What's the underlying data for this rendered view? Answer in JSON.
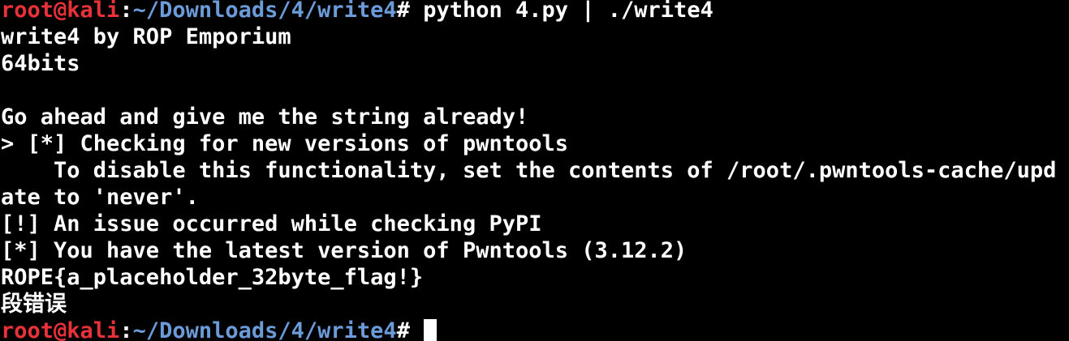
{
  "prompt": {
    "user_host": "root@kali",
    "separator": ":",
    "path": "~/Downloads/4/write4",
    "symbol": "#"
  },
  "first_command": " python 4.py | ./write4",
  "output": {
    "line_1": "write4 by ROP Emporium",
    "line_2": "64bits",
    "line_3": "",
    "line_4": "Go ahead and give me the string already!",
    "line_5": "> [*] Checking for new versions of pwntools",
    "line_6": "    To disable this functionality, set the contents of /root/.pwntools-cache/upd",
    "line_7": "ate to 'never'.",
    "line_8": "[!] An issue occurred while checking PyPI",
    "line_9": "[*] You have the latest version of Pwntools (3.12.2)",
    "line_10": "ROPE{a_placeholder_32byte_flag!}",
    "line_11": "段错误"
  },
  "colors": {
    "background": "#000000",
    "text": "#ffffff",
    "user_host": "#e8323a",
    "path": "#6b9bd8"
  }
}
